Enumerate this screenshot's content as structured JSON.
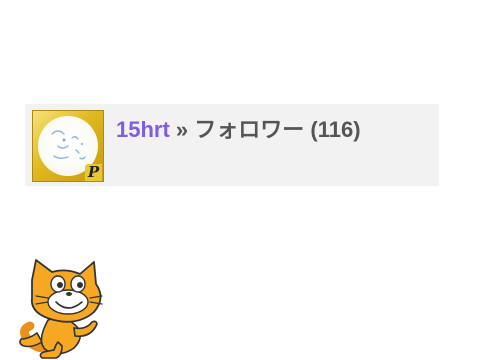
{
  "header": {
    "username": "15hrt",
    "separator": " » ",
    "section_label": "フォロワー",
    "count": "(116)"
  },
  "avatar": {
    "badge_letter": "P",
    "frame_color": "#e0b820"
  },
  "colors": {
    "username_link": "#7f5ce0",
    "title_text": "#555555",
    "header_background": "#f2f2f2"
  },
  "mascot": {
    "icon": "scratch-cat-icon"
  }
}
